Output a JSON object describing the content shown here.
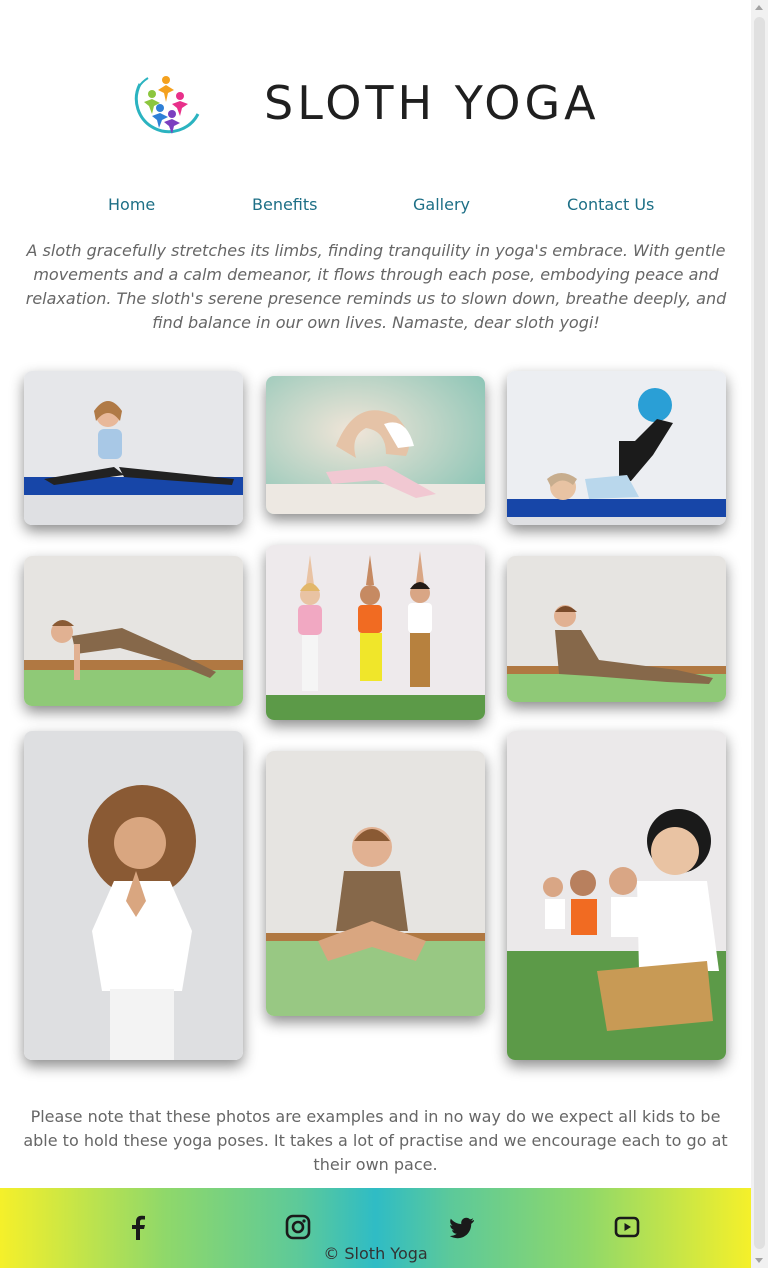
{
  "header": {
    "title": "SLOTH YOGA",
    "logo_icon": "yoga-people-logo-icon"
  },
  "nav": {
    "items": [
      {
        "label": "Home"
      },
      {
        "label": "Benefits"
      },
      {
        "label": "Gallery"
      },
      {
        "label": "Contact Us"
      }
    ],
    "link_color": "#1d6f86"
  },
  "intro": "A sloth gracefully stretches its limbs, finding tranquility in yoga's embrace. With gentle movements and a calm demeanor, it flows through each pose, embodying peace and relaxation. The sloth's serene presence reminds us to slown down, breathe deeply, and find balance in our own lives. Namaste, dear sloth yogi!",
  "gallery": {
    "photos": [
      {
        "description": "girl-doing-splits-on-blue-mat"
      },
      {
        "description": "girl-doing-backbend-stretch"
      },
      {
        "description": "child-lying-with-blue-ball"
      },
      {
        "description": "boy-in-plank-pose-on-green-mat"
      },
      {
        "description": "three-kids-in-tree-pose"
      },
      {
        "description": "boy-in-cobra-pose"
      },
      {
        "description": "girl-with-hands-in-prayer"
      },
      {
        "description": "boy-sitting-cross-legged"
      },
      {
        "description": "kids-meditating-in-a-row"
      }
    ]
  },
  "note": "Please note that these photos are examples and in no way do we expect all kids to be able to hold these yoga poses. It takes a lot of practise and we encourage each to go at their own pace.",
  "footer": {
    "social": [
      {
        "icon": "facebook-icon"
      },
      {
        "icon": "instagram-icon"
      },
      {
        "icon": "twitter-icon"
      },
      {
        "icon": "youtube-icon"
      }
    ],
    "copyright": "© Sloth Yoga",
    "gradient_colors": [
      "#f5f02a",
      "#2fbcc5"
    ]
  }
}
